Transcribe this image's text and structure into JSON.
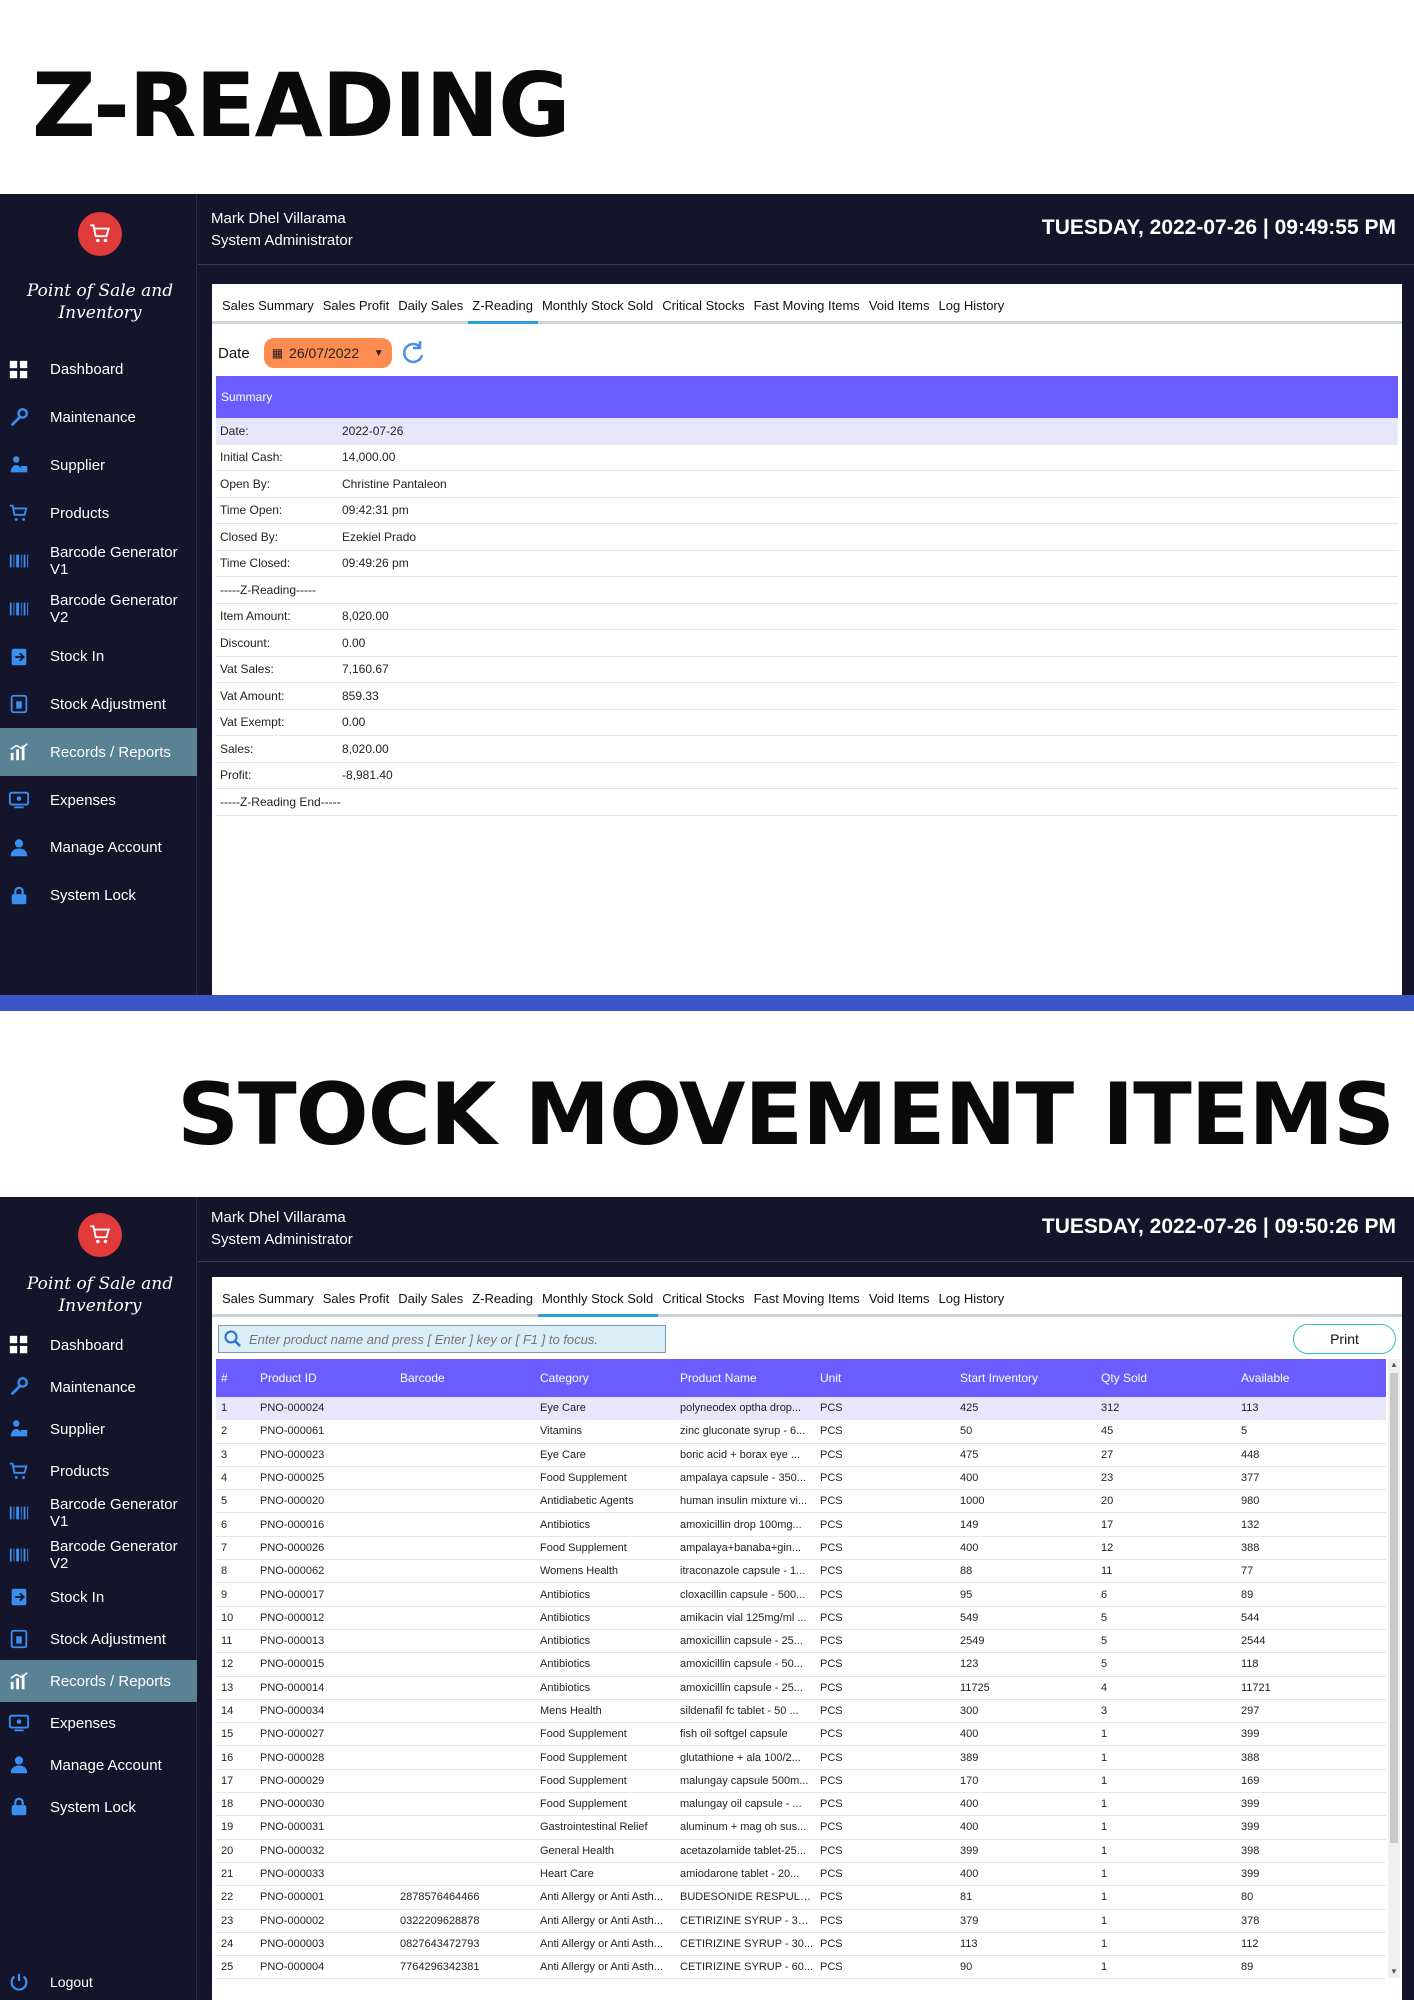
{
  "headings": {
    "z_reading": "Z-READING",
    "stock_movement": "STOCK MOVEMENT ITEMS"
  },
  "colors": {
    "sidebar_bg": "#14142a",
    "active_nav": "#5a8296",
    "table_header": "#6a5cff",
    "date_picker": "#ff8c50",
    "logo": "#e03a3a",
    "separator": "#3a55c8"
  },
  "app": {
    "title": "Point of Sale and Inventory"
  },
  "nav": [
    {
      "label": "Dashboard",
      "icon": "dashboard-icon"
    },
    {
      "label": "Maintenance",
      "icon": "wrench-icon"
    },
    {
      "label": "Supplier",
      "icon": "supplier-icon"
    },
    {
      "label": "Products",
      "icon": "cart-icon"
    },
    {
      "label": "Barcode Generator V1",
      "icon": "barcode-icon"
    },
    {
      "label": "Barcode Generator V2",
      "icon": "barcode-icon"
    },
    {
      "label": "Stock In",
      "icon": "stock-in-icon"
    },
    {
      "label": "Stock Adjustment",
      "icon": "adjustment-icon"
    },
    {
      "label": "Records / Reports",
      "icon": "chart-icon",
      "active": true
    },
    {
      "label": "Expenses",
      "icon": "expenses-icon"
    },
    {
      "label": "Manage Account",
      "icon": "user-icon"
    },
    {
      "label": "System Lock",
      "icon": "lock-icon"
    }
  ],
  "logout_label": "Logout",
  "user": {
    "name": "Mark Dhel Villarama",
    "role": "System Administrator"
  },
  "tabs": [
    "Sales Summary",
    "Sales Profit",
    "Daily Sales",
    "Z-Reading",
    "Monthly Stock Sold",
    "Critical Stocks",
    "Fast Moving Items",
    "Void Items",
    "Log History"
  ],
  "screen1": {
    "datetime": "TUESDAY, 2022-07-26 | 09:49:55 PM",
    "active_tab": "Z-Reading",
    "date_label": "Date",
    "date_value": "26/07/2022",
    "summary_header": "Summary",
    "rows": [
      {
        "k": "Date:",
        "v": "2022-07-26"
      },
      {
        "k": "Initial Cash:",
        "v": "14,000.00"
      },
      {
        "k": "Open By:",
        "v": "Christine Pantaleon"
      },
      {
        "k": "Time Open:",
        "v": "09:42:31 pm"
      },
      {
        "k": "Closed By:",
        "v": "Ezekiel Prado"
      },
      {
        "k": "Time Closed:",
        "v": "09:49:26 pm"
      },
      {
        "k": "-----Z-Reading-----",
        "v": ""
      },
      {
        "k": "Item Amount:",
        "v": "8,020.00"
      },
      {
        "k": "Discount:",
        "v": "0.00"
      },
      {
        "k": "Vat Sales:",
        "v": "7,160.67"
      },
      {
        "k": "Vat Amount:",
        "v": "859.33"
      },
      {
        "k": "Vat Exempt:",
        "v": "0.00"
      },
      {
        "k": "Sales:",
        "v": "8,020.00"
      },
      {
        "k": "Profit:",
        "v": "-8,981.40"
      },
      {
        "k": "-----Z-Reading End-----",
        "v": ""
      }
    ]
  },
  "screen2": {
    "datetime": "TUESDAY, 2022-07-26 | 09:50:26 PM",
    "active_tab": "Monthly Stock Sold",
    "search_placeholder": "Enter product name and press [ Enter ] key or [ F1 ] to focus.",
    "print_label": "Print",
    "columns": [
      "#",
      "Product ID",
      "Barcode",
      "Category",
      "Product Name",
      "Unit",
      "Start Inventory",
      "Qty Sold",
      "Available"
    ],
    "rows": [
      [
        "1",
        "PNO-000024",
        "",
        "Eye Care",
        "polyneodex optha drop...",
        "PCS",
        "425",
        "312",
        "113"
      ],
      [
        "2",
        "PNO-000061",
        "",
        "Vitamins",
        "zinc gluconate syrup - 6...",
        "PCS",
        "50",
        "45",
        "5"
      ],
      [
        "3",
        "PNO-000023",
        "",
        "Eye Care",
        "boric acid + borax eye ...",
        "PCS",
        "475",
        "27",
        "448"
      ],
      [
        "4",
        "PNO-000025",
        "",
        "Food Supplement",
        "ampalaya capsule - 350...",
        "PCS",
        "400",
        "23",
        "377"
      ],
      [
        "5",
        "PNO-000020",
        "",
        "Antidiabetic Agents",
        "human insulin mixture vi...",
        "PCS",
        "1000",
        "20",
        "980"
      ],
      [
        "6",
        "PNO-000016",
        "",
        "Antibiotics",
        "amoxicillin drop 100mg...",
        "PCS",
        "149",
        "17",
        "132"
      ],
      [
        "7",
        "PNO-000026",
        "",
        "Food Supplement",
        "ampalaya+banaba+gin...",
        "PCS",
        "400",
        "12",
        "388"
      ],
      [
        "8",
        "PNO-000062",
        "",
        "Womens Health",
        "itraconazole capsule - 1...",
        "PCS",
        "88",
        "11",
        "77"
      ],
      [
        "9",
        "PNO-000017",
        "",
        "Antibiotics",
        "cloxacillin capsule - 500...",
        "PCS",
        "95",
        "6",
        "89"
      ],
      [
        "10",
        "PNO-000012",
        "",
        "Antibiotics",
        "amikacin vial 125mg/ml ...",
        "PCS",
        "549",
        "5",
        "544"
      ],
      [
        "11",
        "PNO-000013",
        "",
        "Antibiotics",
        "amoxicillin capsule - 25...",
        "PCS",
        "2549",
        "5",
        "2544"
      ],
      [
        "12",
        "PNO-000015",
        "",
        "Antibiotics",
        "amoxicillin capsule - 50...",
        "PCS",
        "123",
        "5",
        "118"
      ],
      [
        "13",
        "PNO-000014",
        "",
        "Antibiotics",
        "amoxicillin capsule - 25...",
        "PCS",
        "11725",
        "4",
        "11721"
      ],
      [
        "14",
        "PNO-000034",
        "",
        "Mens Health",
        "sildenafil fc tablet - 50 ...",
        "PCS",
        "300",
        "3",
        "297"
      ],
      [
        "15",
        "PNO-000027",
        "",
        "Food Supplement",
        "fish oil softgel capsule",
        "PCS",
        "400",
        "1",
        "399"
      ],
      [
        "16",
        "PNO-000028",
        "",
        "Food Supplement",
        "glutathione + ala 100/2...",
        "PCS",
        "389",
        "1",
        "388"
      ],
      [
        "17",
        "PNO-000029",
        "",
        "Food Supplement",
        "malungay capsule 500m...",
        "PCS",
        "170",
        "1",
        "169"
      ],
      [
        "18",
        "PNO-000030",
        "",
        "Food Supplement",
        "malungay oil capsule - ...",
        "PCS",
        "400",
        "1",
        "399"
      ],
      [
        "19",
        "PNO-000031",
        "",
        "Gastrointestinal Relief",
        "aluminum + mag oh sus...",
        "PCS",
        "400",
        "1",
        "399"
      ],
      [
        "20",
        "PNO-000032",
        "",
        "General Health",
        "acetazolamide tablet-25...",
        "PCS",
        "399",
        "1",
        "398"
      ],
      [
        "21",
        "PNO-000033",
        "",
        "Heart Care",
        "amiodarone tablet - 20...",
        "PCS",
        "400",
        "1",
        "399"
      ],
      [
        "22",
        "PNO-000001",
        "2878576464466",
        "Anti Allergy or Anti Asth...",
        "BUDESONIDE RESPULE ...",
        "PCS",
        "81",
        "1",
        "80"
      ],
      [
        "23",
        "PNO-000002",
        "0322209628878",
        "Anti Allergy or Anti Asth...",
        "CETIRIZINE SYRUP - 30 ...",
        "PCS",
        "379",
        "1",
        "378"
      ],
      [
        "24",
        "PNO-000003",
        "0827643472793",
        "Anti Allergy or Anti Asth...",
        "CETIRIZINE SYRUP - 30...",
        "PCS",
        "113",
        "1",
        "112"
      ],
      [
        "25",
        "PNO-000004",
        "7764296342381",
        "Anti Allergy or Anti Asth...",
        "CETIRIZINE SYRUP - 60...",
        "PCS",
        "90",
        "1",
        "89"
      ]
    ]
  }
}
